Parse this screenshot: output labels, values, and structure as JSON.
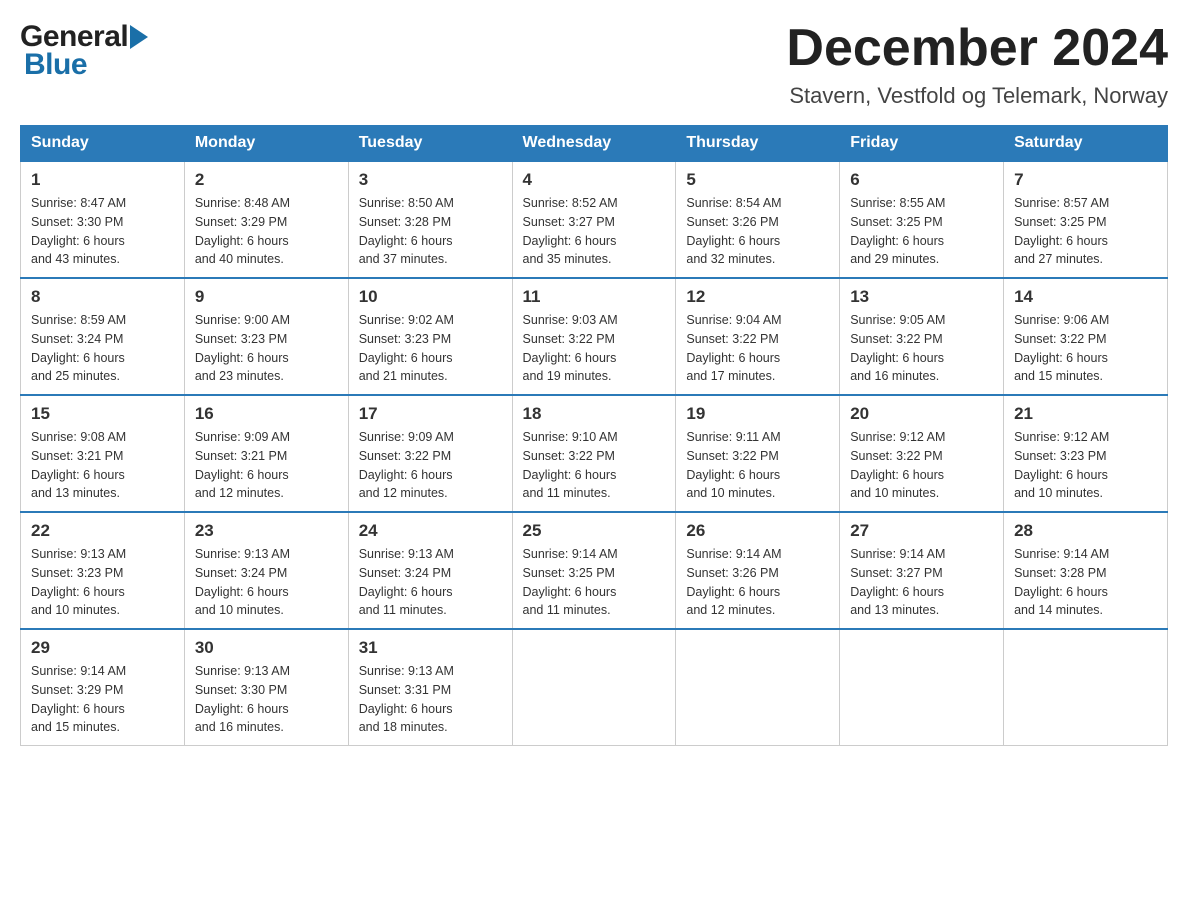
{
  "header": {
    "month_title": "December 2024",
    "subtitle": "Stavern, Vestfold og Telemark, Norway",
    "logo_general": "General",
    "logo_blue": "Blue"
  },
  "calendar": {
    "days_of_week": [
      "Sunday",
      "Monday",
      "Tuesday",
      "Wednesday",
      "Thursday",
      "Friday",
      "Saturday"
    ],
    "weeks": [
      [
        {
          "day": "1",
          "info": "Sunrise: 8:47 AM\nSunset: 3:30 PM\nDaylight: 6 hours\nand 43 minutes."
        },
        {
          "day": "2",
          "info": "Sunrise: 8:48 AM\nSunset: 3:29 PM\nDaylight: 6 hours\nand 40 minutes."
        },
        {
          "day": "3",
          "info": "Sunrise: 8:50 AM\nSunset: 3:28 PM\nDaylight: 6 hours\nand 37 minutes."
        },
        {
          "day": "4",
          "info": "Sunrise: 8:52 AM\nSunset: 3:27 PM\nDaylight: 6 hours\nand 35 minutes."
        },
        {
          "day": "5",
          "info": "Sunrise: 8:54 AM\nSunset: 3:26 PM\nDaylight: 6 hours\nand 32 minutes."
        },
        {
          "day": "6",
          "info": "Sunrise: 8:55 AM\nSunset: 3:25 PM\nDaylight: 6 hours\nand 29 minutes."
        },
        {
          "day": "7",
          "info": "Sunrise: 8:57 AM\nSunset: 3:25 PM\nDaylight: 6 hours\nand 27 minutes."
        }
      ],
      [
        {
          "day": "8",
          "info": "Sunrise: 8:59 AM\nSunset: 3:24 PM\nDaylight: 6 hours\nand 25 minutes."
        },
        {
          "day": "9",
          "info": "Sunrise: 9:00 AM\nSunset: 3:23 PM\nDaylight: 6 hours\nand 23 minutes."
        },
        {
          "day": "10",
          "info": "Sunrise: 9:02 AM\nSunset: 3:23 PM\nDaylight: 6 hours\nand 21 minutes."
        },
        {
          "day": "11",
          "info": "Sunrise: 9:03 AM\nSunset: 3:22 PM\nDaylight: 6 hours\nand 19 minutes."
        },
        {
          "day": "12",
          "info": "Sunrise: 9:04 AM\nSunset: 3:22 PM\nDaylight: 6 hours\nand 17 minutes."
        },
        {
          "day": "13",
          "info": "Sunrise: 9:05 AM\nSunset: 3:22 PM\nDaylight: 6 hours\nand 16 minutes."
        },
        {
          "day": "14",
          "info": "Sunrise: 9:06 AM\nSunset: 3:22 PM\nDaylight: 6 hours\nand 15 minutes."
        }
      ],
      [
        {
          "day": "15",
          "info": "Sunrise: 9:08 AM\nSunset: 3:21 PM\nDaylight: 6 hours\nand 13 minutes."
        },
        {
          "day": "16",
          "info": "Sunrise: 9:09 AM\nSunset: 3:21 PM\nDaylight: 6 hours\nand 12 minutes."
        },
        {
          "day": "17",
          "info": "Sunrise: 9:09 AM\nSunset: 3:22 PM\nDaylight: 6 hours\nand 12 minutes."
        },
        {
          "day": "18",
          "info": "Sunrise: 9:10 AM\nSunset: 3:22 PM\nDaylight: 6 hours\nand 11 minutes."
        },
        {
          "day": "19",
          "info": "Sunrise: 9:11 AM\nSunset: 3:22 PM\nDaylight: 6 hours\nand 10 minutes."
        },
        {
          "day": "20",
          "info": "Sunrise: 9:12 AM\nSunset: 3:22 PM\nDaylight: 6 hours\nand 10 minutes."
        },
        {
          "day": "21",
          "info": "Sunrise: 9:12 AM\nSunset: 3:23 PM\nDaylight: 6 hours\nand 10 minutes."
        }
      ],
      [
        {
          "day": "22",
          "info": "Sunrise: 9:13 AM\nSunset: 3:23 PM\nDaylight: 6 hours\nand 10 minutes."
        },
        {
          "day": "23",
          "info": "Sunrise: 9:13 AM\nSunset: 3:24 PM\nDaylight: 6 hours\nand 10 minutes."
        },
        {
          "day": "24",
          "info": "Sunrise: 9:13 AM\nSunset: 3:24 PM\nDaylight: 6 hours\nand 11 minutes."
        },
        {
          "day": "25",
          "info": "Sunrise: 9:14 AM\nSunset: 3:25 PM\nDaylight: 6 hours\nand 11 minutes."
        },
        {
          "day": "26",
          "info": "Sunrise: 9:14 AM\nSunset: 3:26 PM\nDaylight: 6 hours\nand 12 minutes."
        },
        {
          "day": "27",
          "info": "Sunrise: 9:14 AM\nSunset: 3:27 PM\nDaylight: 6 hours\nand 13 minutes."
        },
        {
          "day": "28",
          "info": "Sunrise: 9:14 AM\nSunset: 3:28 PM\nDaylight: 6 hours\nand 14 minutes."
        }
      ],
      [
        {
          "day": "29",
          "info": "Sunrise: 9:14 AM\nSunset: 3:29 PM\nDaylight: 6 hours\nand 15 minutes."
        },
        {
          "day": "30",
          "info": "Sunrise: 9:13 AM\nSunset: 3:30 PM\nDaylight: 6 hours\nand 16 minutes."
        },
        {
          "day": "31",
          "info": "Sunrise: 9:13 AM\nSunset: 3:31 PM\nDaylight: 6 hours\nand 18 minutes."
        },
        {
          "day": "",
          "info": ""
        },
        {
          "day": "",
          "info": ""
        },
        {
          "day": "",
          "info": ""
        },
        {
          "day": "",
          "info": ""
        }
      ]
    ]
  }
}
